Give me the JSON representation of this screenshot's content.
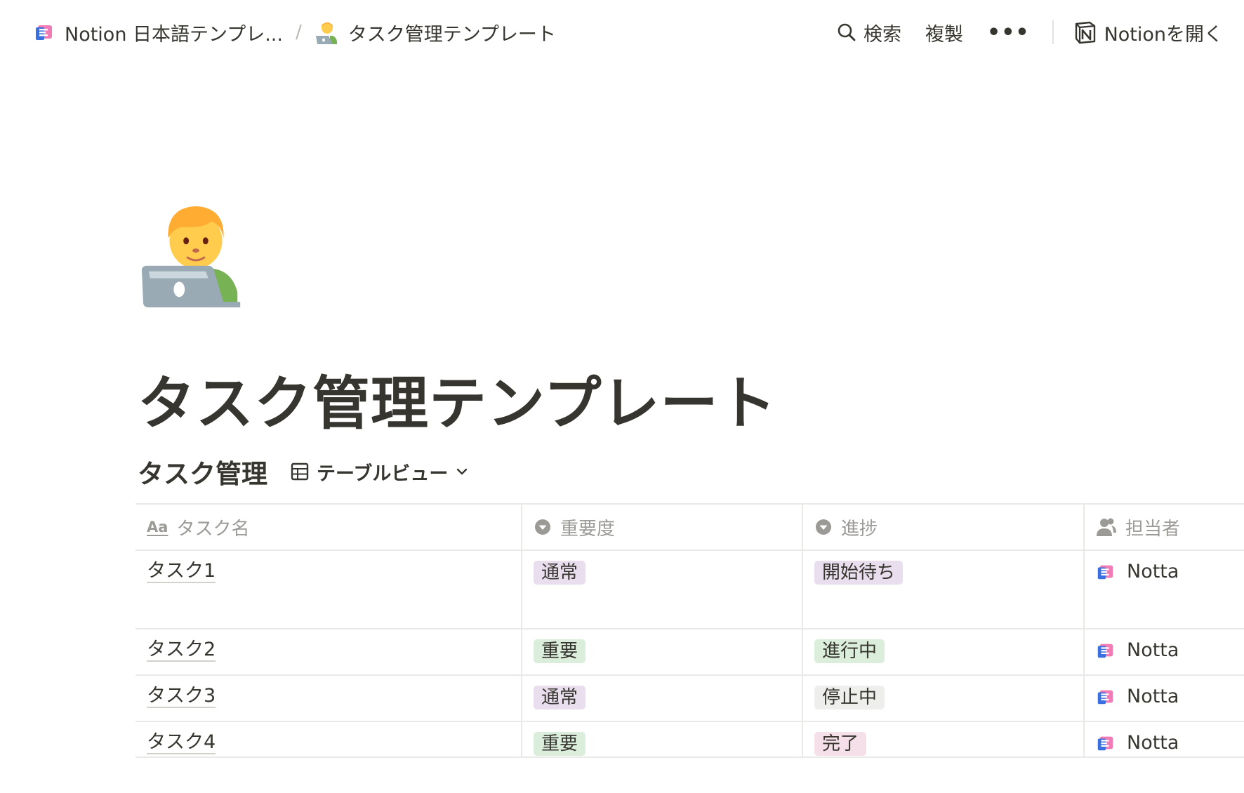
{
  "topbar": {
    "breadcrumbs": [
      {
        "label": "Notion 日本語テンプレ..."
      },
      {
        "label": "タスク管理テンプレート"
      }
    ],
    "separator": "/",
    "search_label": "検索",
    "duplicate_label": "複製",
    "more_label": "•••",
    "open_in_notion_label": "Notionを開く"
  },
  "page": {
    "icon": "technologist-emoji-icon",
    "title": "タスク管理テンプレート"
  },
  "database": {
    "title": "タスク管理",
    "view_label": "テーブルビュー",
    "columns": [
      {
        "label": "タスク名",
        "type_icon": "text-type-icon",
        "type_glyph": "Aa"
      },
      {
        "label": "重要度",
        "type_icon": "select-type-icon"
      },
      {
        "label": "進捗",
        "type_icon": "select-type-icon"
      },
      {
        "label": "担当者",
        "type_icon": "person-type-icon"
      }
    ],
    "rows": [
      {
        "name": "タスク1",
        "priority": "通常",
        "priority_color": "#e8deee",
        "status": "開始待ち",
        "status_color": "#e8deee",
        "assignee": "Notta"
      },
      {
        "name": "タスク2",
        "priority": "重要",
        "priority_color": "#dbeddb",
        "status": "進行中",
        "status_color": "#dbeddb",
        "assignee": "Notta"
      },
      {
        "name": "タスク3",
        "priority": "通常",
        "priority_color": "#e8deee",
        "status": "停止中",
        "status_color": "#eeeeed",
        "assignee": "Notta"
      },
      {
        "name": "タスク4",
        "priority": "重要",
        "priority_color": "#dbeddb",
        "status": "完了",
        "status_color": "#f5e0e9",
        "assignee": "Notta"
      }
    ]
  },
  "colors": {
    "text": "#37352f",
    "muted": "#9b9a97",
    "border": "#e9e9e7"
  }
}
